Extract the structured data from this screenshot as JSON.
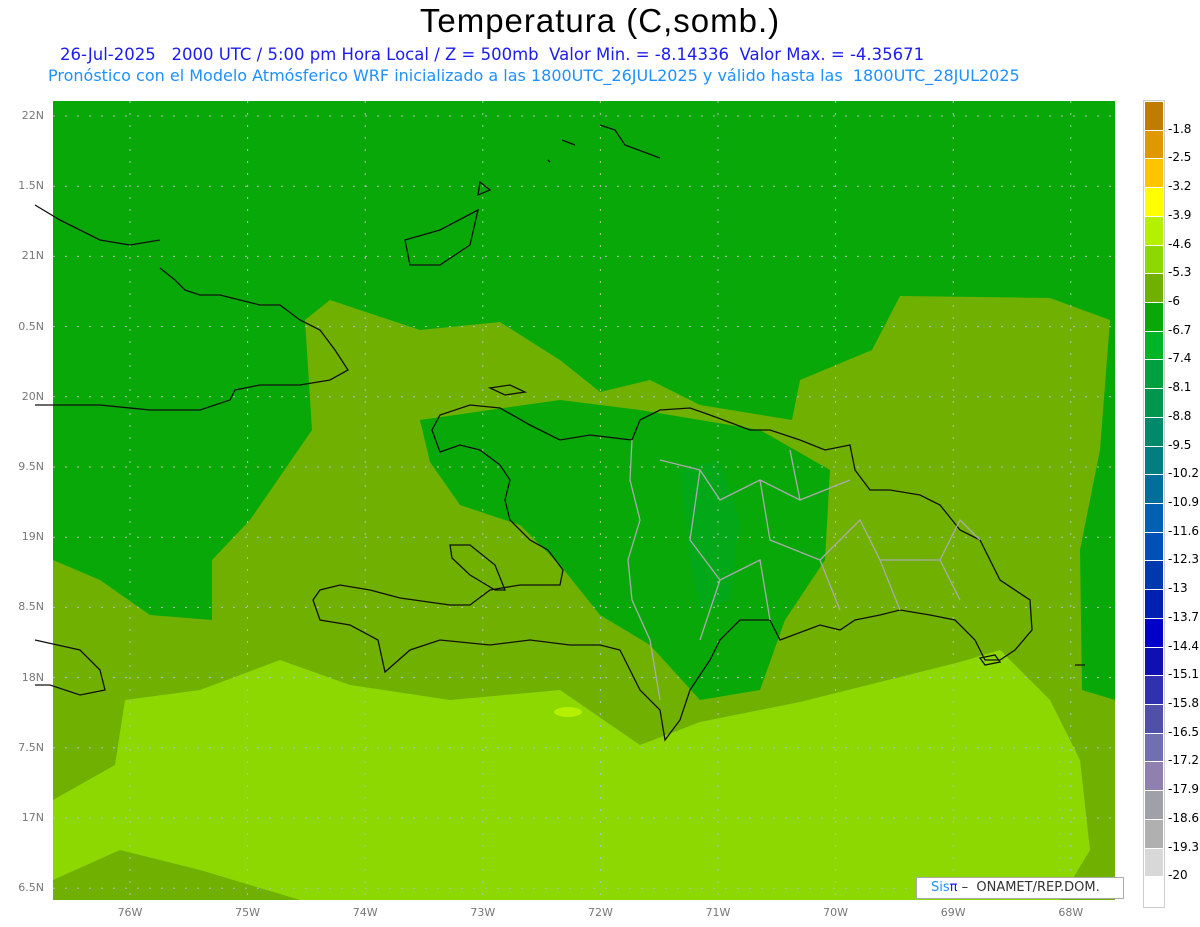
{
  "header": {
    "title": "Temperatura (C,somb.)",
    "line1": "26-Jul-2025   2000 UTC / 5:00 pm Hora Local / Z = 500mb  Valor Min. = -8.14336  Valor Max. = -4.35671",
    "line2": "Pronóstico con el Modelo Atmósferico WRF inicializado a las 1800UTC_26JUL2025 y válido hasta las  1800UTC_28JUL2025"
  },
  "axes": {
    "lat_labels": [
      "22N",
      "1.5N",
      "21N",
      "0.5N",
      "20N",
      "9.5N",
      "19N",
      "8.5N",
      "18N",
      "7.5N",
      "17N",
      "6.5N"
    ],
    "lon_labels": [
      "76W",
      "75W",
      "74W",
      "73W",
      "72W",
      "71W",
      "70W",
      "69W",
      "68W"
    ]
  },
  "colorbar": {
    "labels": [
      "-1.8",
      "-2.5",
      "-3.2",
      "-3.9",
      "-4.6",
      "-5.3",
      "-6",
      "-6.7",
      "-7.4",
      "-8.1",
      "-8.8",
      "-9.5",
      "-10.2",
      "-10.9",
      "-11.6",
      "-12.3",
      "-13",
      "-13.7",
      "-14.4",
      "-15.1",
      "-15.8",
      "-16.5",
      "-17.2",
      "-17.9",
      "-18.6",
      "-19.3",
      "-20"
    ],
    "colors": [
      "#c07c00",
      "#e09800",
      "#ffc400",
      "#ffff00",
      "#b4f000",
      "#8cd800",
      "#70b000",
      "#08a808",
      "#00b428",
      "#00a040",
      "#009650",
      "#008a6c",
      "#007e80",
      "#00709a",
      "#0060b4",
      "#0050b8",
      "#0038b0",
      "#0020b0",
      "#0000c8",
      "#1010b0",
      "#3030b0",
      "#5050a8",
      "#7070b0",
      "#9080b0",
      "#a0a0a8",
      "#b0b0b0",
      "#d8d8d8",
      "#ffffff"
    ]
  },
  "map_colors": {
    "green": "#08a808",
    "olive": "#70b000",
    "light": "#8cd800",
    "spot": "#00a824"
  },
  "credit": {
    "sis": "Sis",
    "pi": "π",
    "rest": " –  ONAMET/REP.DOM."
  }
}
